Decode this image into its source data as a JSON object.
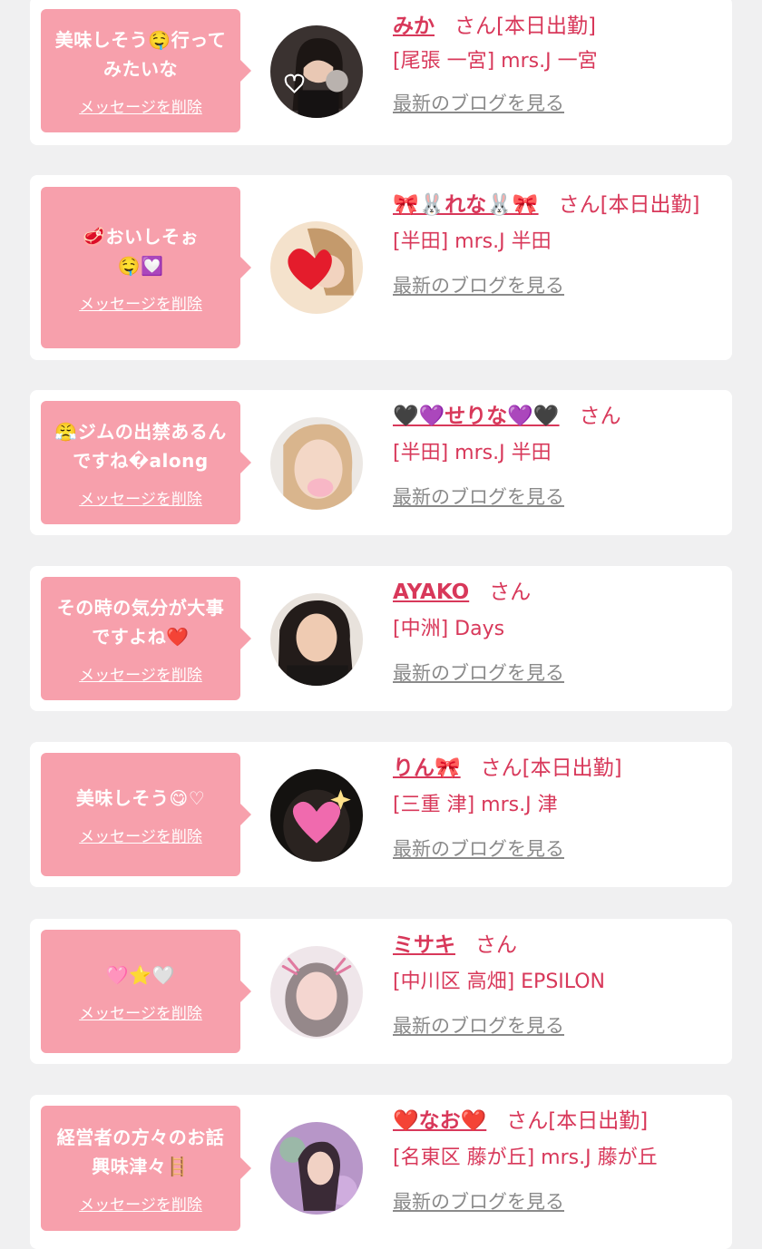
{
  "delete_label": "メッセージを削除",
  "blog_label": "最新のブログを見る",
  "san_suffix": "さん",
  "cards": [
    {
      "message": "美味しそう🤤行ってみたいな",
      "name": "みか",
      "status": "[本日出勤]",
      "shop": "[尾張 一宮] mrs.J 一宮",
      "avatar_icon": "woman-portrait-icon"
    },
    {
      "message": "🥩おいしそぉ🤤💟",
      "name": "🎀🐰れな🐰🎀",
      "status": "[本日出勤]",
      "shop": "[半田] mrs.J 半田",
      "avatar_icon": "heart-covered-portrait-icon"
    },
    {
      "message": "😤ジムの出禁あるんですね�along",
      "name": "🖤💜せりな💜🖤",
      "status": "",
      "shop": "[半田] mrs.J 半田",
      "avatar_icon": "woman-portrait-icon"
    },
    {
      "message": "その時の気分が大事ですよね❤️",
      "name": "AYAKO",
      "status": "",
      "shop": "[中洲] Days",
      "avatar_icon": "woman-portrait-icon"
    },
    {
      "message": "美味しそう😋♡",
      "name": "りん🎀",
      "status": "[本日出勤]",
      "shop": "[三重 津] mrs.J 津",
      "avatar_icon": "sparkle-heart-portrait-icon"
    },
    {
      "message": "🩷⭐🤍",
      "name": "ミサキ",
      "status": "",
      "shop": "[中川区 高畑] EPSILON",
      "avatar_icon": "blurred-portrait-icon"
    },
    {
      "message": "経営者の方々のお話興味津々🪜",
      "name": "❤️なお❤️",
      "status": "[本日出勤]",
      "shop": "[名東区 藤が丘] mrs.J 藤が丘",
      "avatar_icon": "woman-portrait-icon"
    }
  ],
  "colors": {
    "background": "#f0f0f1",
    "card": "#ffffff",
    "bubble": "#f7a0ac",
    "accent": "#d8385a",
    "link_gray": "#8a8a8a"
  }
}
